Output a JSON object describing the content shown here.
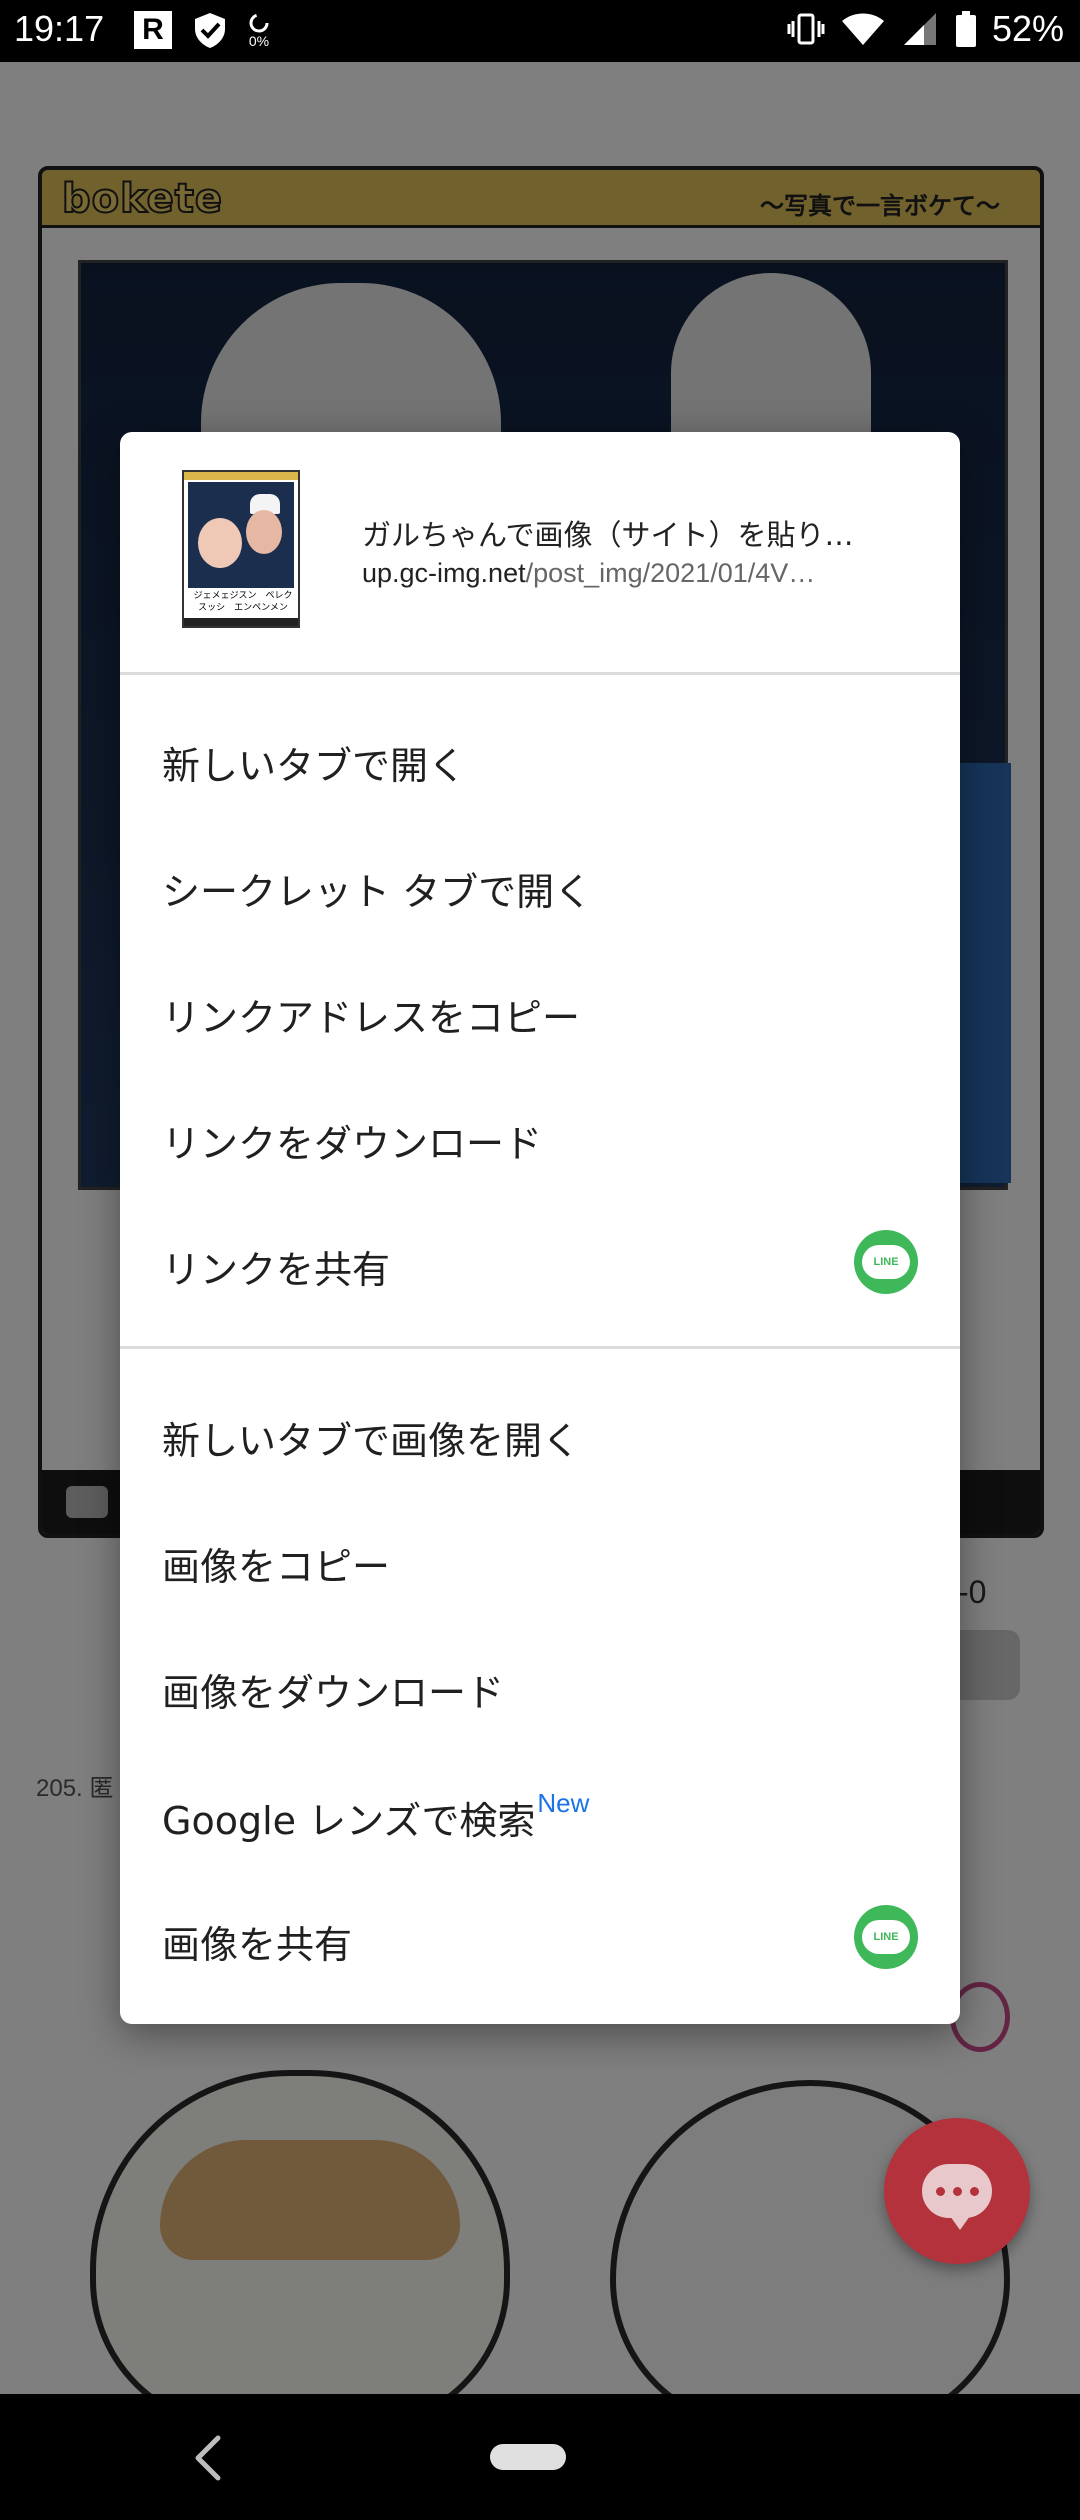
{
  "status_bar": {
    "time": "19:17",
    "r_badge": "R",
    "data_percent": "0%",
    "battery_percent": "52%"
  },
  "background": {
    "logo": "bokete",
    "tagline": "〜写真で一言ボケて〜",
    "score": "-0",
    "caption": "205. 匿"
  },
  "context_menu": {
    "header": {
      "title": "ガルちゃんで画像（サイト）を貼り…",
      "url_host": "up.gc-img.net",
      "url_path": "/post_img/2021/01/4V…",
      "thumbnail_caption": "ジェメェジスン　ペレクスッシ　エンペンメン"
    },
    "link_items": [
      "新しいタブで開く",
      "シークレット タブで開く",
      "リンクアドレスをコピー",
      "リンクをダウンロード",
      "リンクを共有"
    ],
    "image_items": [
      "新しいタブで画像を開く",
      "画像をコピー",
      "画像をダウンロード",
      "Google レンズで検索",
      "画像を共有"
    ],
    "new_badge": "New",
    "line_label": "LINE"
  },
  "colors": {
    "accent_blue": "#1a73e8",
    "line_green": "#3fb85a",
    "fab_red": "#b3323c"
  }
}
